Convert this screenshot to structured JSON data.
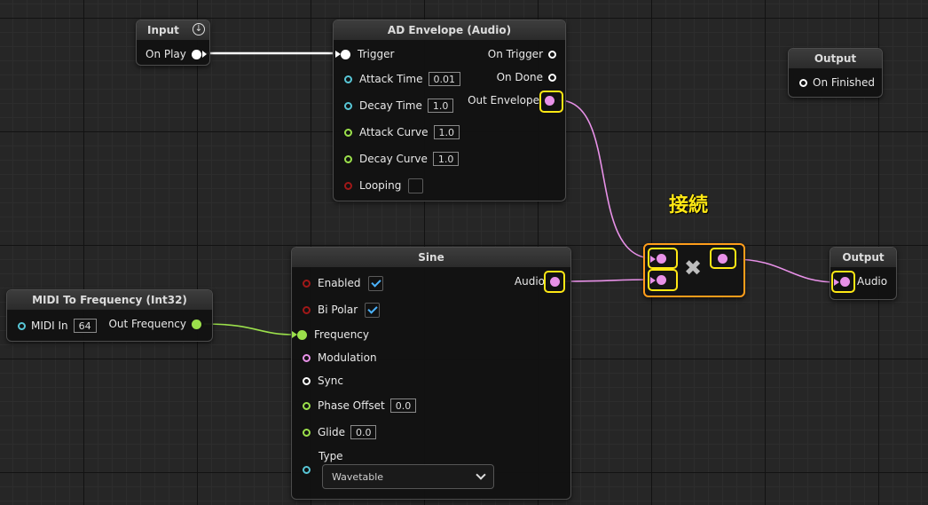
{
  "annotation": "接続",
  "nodes": {
    "input": {
      "title": "Input",
      "pin": "On Play"
    },
    "ad_envelope": {
      "title": "AD Envelope (Audio)",
      "inputs": {
        "trigger": "Trigger",
        "attack_time": "Attack Time",
        "attack_time_value": "0.01",
        "decay_time": "Decay Time",
        "decay_time_value": "1.0",
        "attack_curve": "Attack Curve",
        "attack_curve_value": "1.0",
        "decay_curve": "Decay Curve",
        "decay_curve_value": "1.0",
        "looping": "Looping"
      },
      "outputs": {
        "on_trigger": "On Trigger",
        "on_done": "On Done",
        "out_envelope": "Out Envelope"
      }
    },
    "output_finished": {
      "title": "Output",
      "pin": "On Finished"
    },
    "midi_to_freq": {
      "title": "MIDI To Frequency (Int32)",
      "input": "MIDI In",
      "input_value": "64",
      "output": "Out Frequency"
    },
    "sine": {
      "title": "Sine",
      "inputs": {
        "enabled": "Enabled",
        "bi_polar": "Bi Polar",
        "frequency": "Frequency",
        "modulation": "Modulation",
        "sync": "Sync",
        "phase_offset": "Phase Offset",
        "phase_offset_value": "0.0",
        "glide": "Glide",
        "glide_value": "0.0",
        "type": "Type",
        "type_value": "Wavetable"
      },
      "output": "Audio"
    },
    "multiply": {
      "symbol": "✖"
    },
    "output_audio": {
      "title": "Output",
      "pin": "Audio"
    }
  },
  "colors": {
    "audio": "#e891e8",
    "float": "#9be04b",
    "time": "#58c6d6",
    "bool": "#8a0f0f",
    "trigger": "#ffffff",
    "highlight": "#ffe814",
    "select_outline": "#ff9d1a"
  },
  "checks": {
    "enabled": true,
    "bi_polar": true,
    "looping": false
  }
}
